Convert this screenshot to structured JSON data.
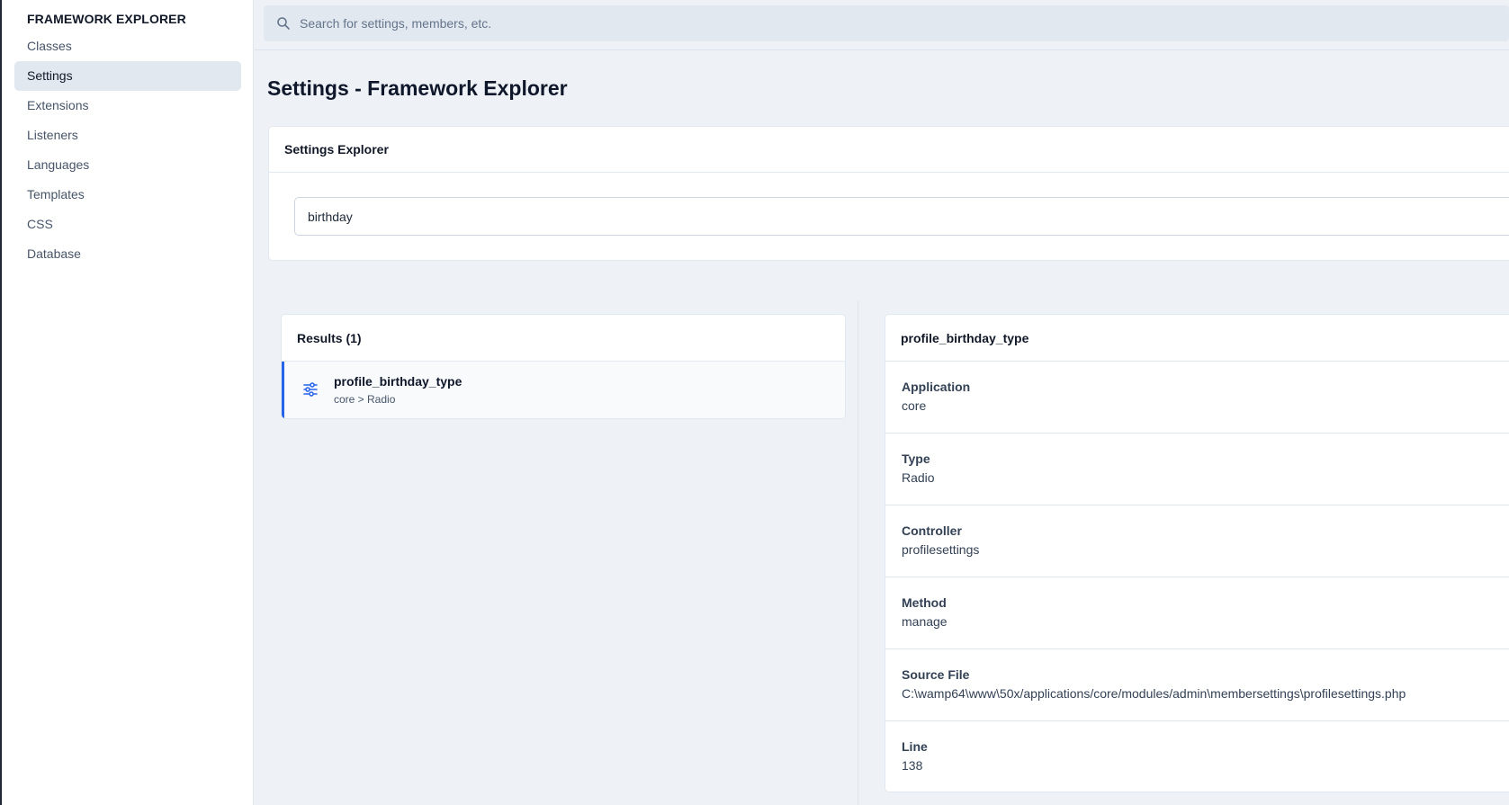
{
  "sidebar": {
    "title": "FRAMEWORK EXPLORER",
    "items": [
      {
        "label": "Classes"
      },
      {
        "label": "Settings"
      },
      {
        "label": "Extensions"
      },
      {
        "label": "Listeners"
      },
      {
        "label": "Languages"
      },
      {
        "label": "Templates"
      },
      {
        "label": "CSS"
      },
      {
        "label": "Database"
      }
    ],
    "active_item": "Settings"
  },
  "topbar": {
    "search_placeholder": "Search for settings, members, etc."
  },
  "page": {
    "title": "Settings - Framework Explorer"
  },
  "explorer": {
    "header": "Settings Explorer",
    "query": "birthday"
  },
  "results": {
    "header": "Results (1)",
    "items": [
      {
        "name": "profile_birthday_type",
        "path": "core > Radio"
      }
    ]
  },
  "detail": {
    "header": "profile_birthday_type",
    "fields": [
      {
        "label": "Application",
        "value": "core"
      },
      {
        "label": "Type",
        "value": "Radio"
      },
      {
        "label": "Controller",
        "value": "profilesettings"
      },
      {
        "label": "Method",
        "value": "manage"
      },
      {
        "label": "Source File",
        "value": "C:\\wamp64\\www\\50x/applications/core/modules/admin\\membersettings\\profilesettings.php"
      },
      {
        "label": "Line",
        "value": "138"
      }
    ]
  },
  "colors": {
    "accent": "#2563eb",
    "active_nav_bg": "#e2e8f0",
    "page_bg": "#eef2f7"
  },
  "icons": {
    "search": "search-icon",
    "setting": "sliders-icon"
  }
}
